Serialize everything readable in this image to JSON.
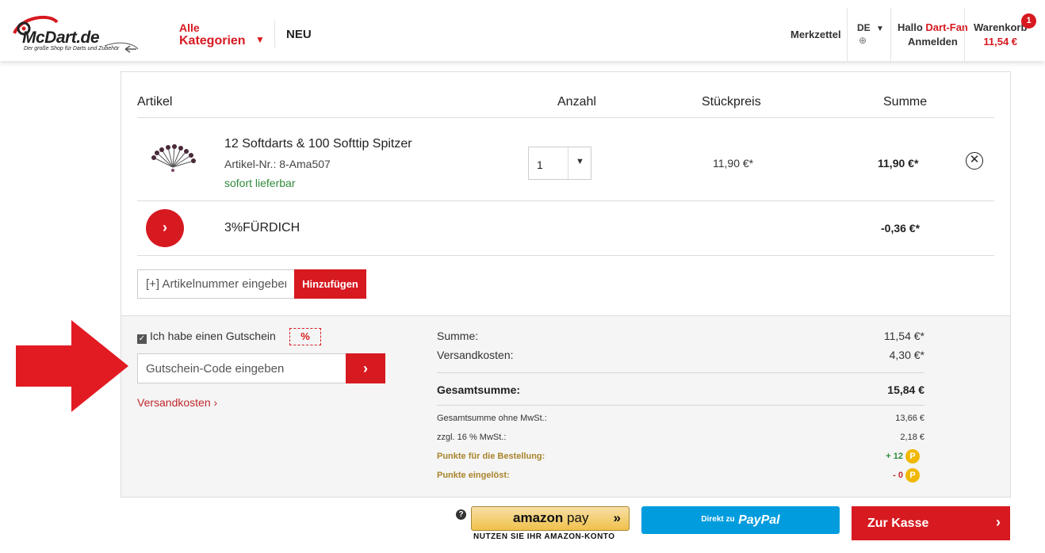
{
  "header": {
    "logo_brand": "McDart",
    "logo_tld": ".de",
    "logo_slogan": "Der große Shop für Darts und Zubehör",
    "categories_line1": "Alle",
    "categories_line2": "Kategorien",
    "new_label": "NEU",
    "wishlist_label": "Merkzettel",
    "language": "DE",
    "greeting_prefix": "Hallo",
    "greeting_name": "Dart-Fan",
    "login_label": "Anmelden",
    "cart_label": "Warenkorb",
    "cart_total": "11,54 €",
    "cart_count": "1"
  },
  "table": {
    "col_article": "Artikel",
    "col_qty": "Anzahl",
    "col_unit": "Stückpreis",
    "col_sum": "Summe"
  },
  "item": {
    "title": "12 Softdarts & 100 Softtip Spitzer",
    "article_nr": "Artikel-Nr.: 8-Ama507",
    "availability": "sofort lieferbar",
    "quantity": "1",
    "unit_price": "11,90 €*",
    "sum_price": "11,90 €*"
  },
  "promo": {
    "code": "3%FÜRDICH",
    "value": "-0,36 €*"
  },
  "add_article": {
    "placeholder": "[+] Artikelnummer eingeben",
    "button": "Hinzufügen"
  },
  "voucher": {
    "checkbox_label": "Ich habe einen Gutschein",
    "icon_text": "%",
    "placeholder": "Gutschein-Code eingeben",
    "shipping_link": "Versandkosten ›"
  },
  "summary": {
    "sum_label": "Summe:",
    "sum_value": "11,54 €*",
    "shipping_label": "Versandkosten:",
    "shipping_value": "4,30 €*",
    "total_label": "Gesamtsumme:",
    "total_value": "15,84 €",
    "net_label": "Gesamtsumme ohne MwSt.:",
    "net_value": "13,66 €",
    "vat_label": "zzgl. 16 % MwSt.:",
    "vat_value": "2,18 €",
    "points_order_label": "Punkte für die Bestellung:",
    "points_order_value": "+ 12",
    "points_redeemed_label": "Punkte eingelöst:",
    "points_redeemed_value": "- 0",
    "points_icon": "P"
  },
  "payment": {
    "amazon_label_a": "amazon",
    "amazon_label_b": "pay",
    "amazon_sub": "NUTZEN SIE IHR AMAZON-KONTO",
    "paypal_prefix": "Direkt zu",
    "paypal_label": "PayPal",
    "checkout_label": "Zur Kasse"
  },
  "colors": {
    "brand_red": "#d71920",
    "stock_green": "#2f8a3a",
    "points_gold": "#a8842b",
    "paypal_blue": "#009cde"
  }
}
